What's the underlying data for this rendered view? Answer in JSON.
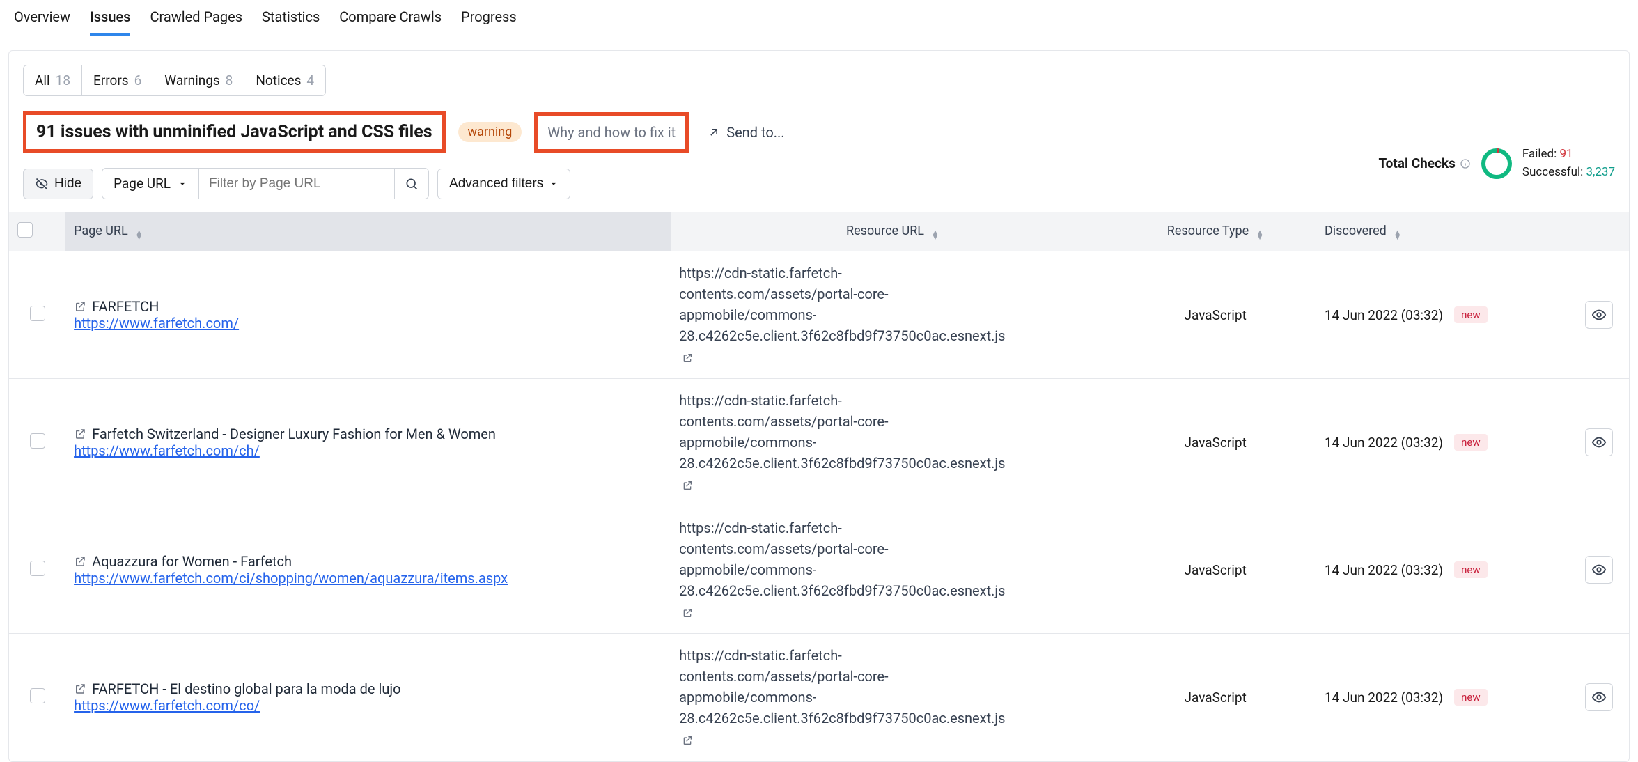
{
  "nav_tabs": [
    "Overview",
    "Issues",
    "Crawled Pages",
    "Statistics",
    "Compare Crawls",
    "Progress"
  ],
  "active_tab": "Issues",
  "filter_pills": [
    {
      "label": "All",
      "count": "18"
    },
    {
      "label": "Errors",
      "count": "6"
    },
    {
      "label": "Warnings",
      "count": "8"
    },
    {
      "label": "Notices",
      "count": "4"
    }
  ],
  "title": "91 issues with unminified JavaScript and CSS files",
  "warning_badge": "warning",
  "fixit_text": "Why and how to fix it",
  "sendto_text": "Send to...",
  "hide_label": "Hide",
  "page_url_selector": "Page URL",
  "filter_placeholder": "Filter by Page URL",
  "advanced_filters": "Advanced filters",
  "stats": {
    "title": "Total Checks",
    "failed_label": "Failed:",
    "failed_value": "91",
    "success_label": "Successful:",
    "success_value": "3,237"
  },
  "columns": {
    "page_url": "Page URL",
    "resource_url": "Resource URL",
    "resource_type": "Resource Type",
    "discovered": "Discovered"
  },
  "new_badge": "new",
  "rows": [
    {
      "page_title": "FARFETCH",
      "page_url": "https://www.farfetch.com/",
      "resource_url": "https://cdn-static.farfetch-contents.com/assets/portal-core-appmobile/commons-28.c4262c5e.client.3f62c8fbd9f73750c0ac.esnext.js",
      "resource_type": "JavaScript",
      "discovered": "14 Jun 2022 (03:32)"
    },
    {
      "page_title": "Farfetch Switzerland - Designer Luxury Fashion for Men & Women",
      "page_url": "https://www.farfetch.com/ch/",
      "resource_url": "https://cdn-static.farfetch-contents.com/assets/portal-core-appmobile/commons-28.c4262c5e.client.3f62c8fbd9f73750c0ac.esnext.js",
      "resource_type": "JavaScript",
      "discovered": "14 Jun 2022 (03:32)"
    },
    {
      "page_title": "Aquazzura for Women - Farfetch",
      "page_url": "https://www.farfetch.com/ci/shopping/women/aquazzura/items.aspx",
      "resource_url": "https://cdn-static.farfetch-contents.com/assets/portal-core-appmobile/commons-28.c4262c5e.client.3f62c8fbd9f73750c0ac.esnext.js",
      "resource_type": "JavaScript",
      "discovered": "14 Jun 2022 (03:32)"
    },
    {
      "page_title": "FARFETCH - El destino global para la moda de lujo",
      "page_url": "https://www.farfetch.com/co/",
      "resource_url": "https://cdn-static.farfetch-contents.com/assets/portal-core-appmobile/commons-28.c4262c5e.client.3f62c8fbd9f73750c0ac.esnext.js",
      "resource_type": "JavaScript",
      "discovered": "14 Jun 2022 (03:32)"
    }
  ]
}
